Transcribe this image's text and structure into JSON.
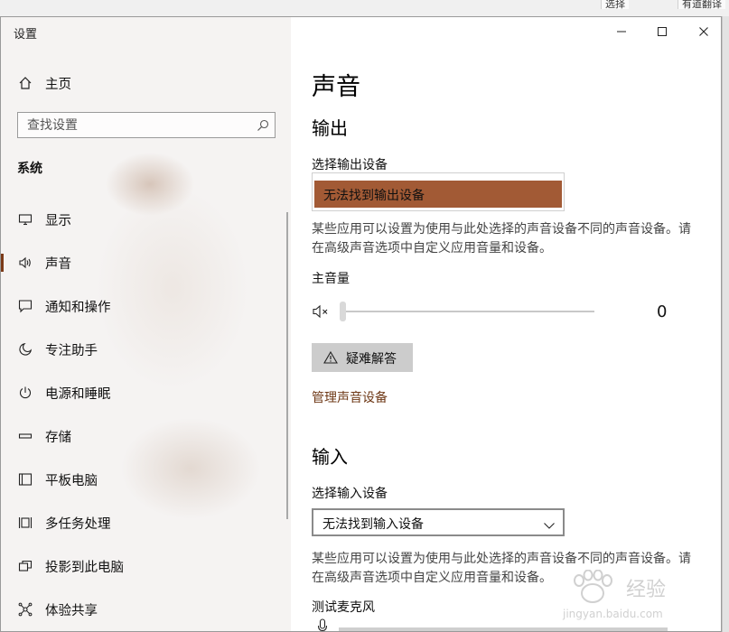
{
  "window": {
    "title": "设置"
  },
  "background_app": {
    "toolbar_select": "选择",
    "toolbar_translate": "有道翻译"
  },
  "sidebar": {
    "home_label": "主页",
    "search_placeholder": "查找设置",
    "section_label": "系统",
    "items": [
      {
        "label": "显示",
        "icon": "monitor-icon"
      },
      {
        "label": "声音",
        "icon": "speaker-icon",
        "active": true
      },
      {
        "label": "通知和操作",
        "icon": "notification-icon"
      },
      {
        "label": "专注助手",
        "icon": "moon-icon"
      },
      {
        "label": "电源和睡眠",
        "icon": "power-icon"
      },
      {
        "label": "存储",
        "icon": "storage-icon"
      },
      {
        "label": "平板电脑",
        "icon": "tablet-icon"
      },
      {
        "label": "多任务处理",
        "icon": "multitask-icon"
      },
      {
        "label": "投影到此电脑",
        "icon": "project-icon"
      },
      {
        "label": "体验共享",
        "icon": "share-icon"
      }
    ]
  },
  "main": {
    "page_title": "声音",
    "output": {
      "heading": "输出",
      "select_label": "选择输出设备",
      "selected_device": "无法找到输出设备",
      "description": "某些应用可以设置为使用与此处选择的声音设备不同的声音设备。请在高级声音选项中自定义应用音量和设备。",
      "master_volume_label": "主音量",
      "volume_value": "0",
      "volume_fraction": 0,
      "troubleshoot_label": "疑难解答",
      "manage_link": "管理声音设备"
    },
    "input": {
      "heading": "输入",
      "select_label": "选择输入设备",
      "selected_device": "无法找到输入设备",
      "description": "某些应用可以设置为使用与此处选择的声音设备不同的声音设备。请在高级声音选项中自定义应用音量和设备。",
      "test_mic_label": "测试麦克风"
    }
  },
  "watermark": {
    "text": "经验",
    "sub": "jingyan.baidu.com"
  },
  "colors": {
    "accent": "#a25a35",
    "active_bar": "#7b3a18",
    "link": "#6e3816"
  }
}
